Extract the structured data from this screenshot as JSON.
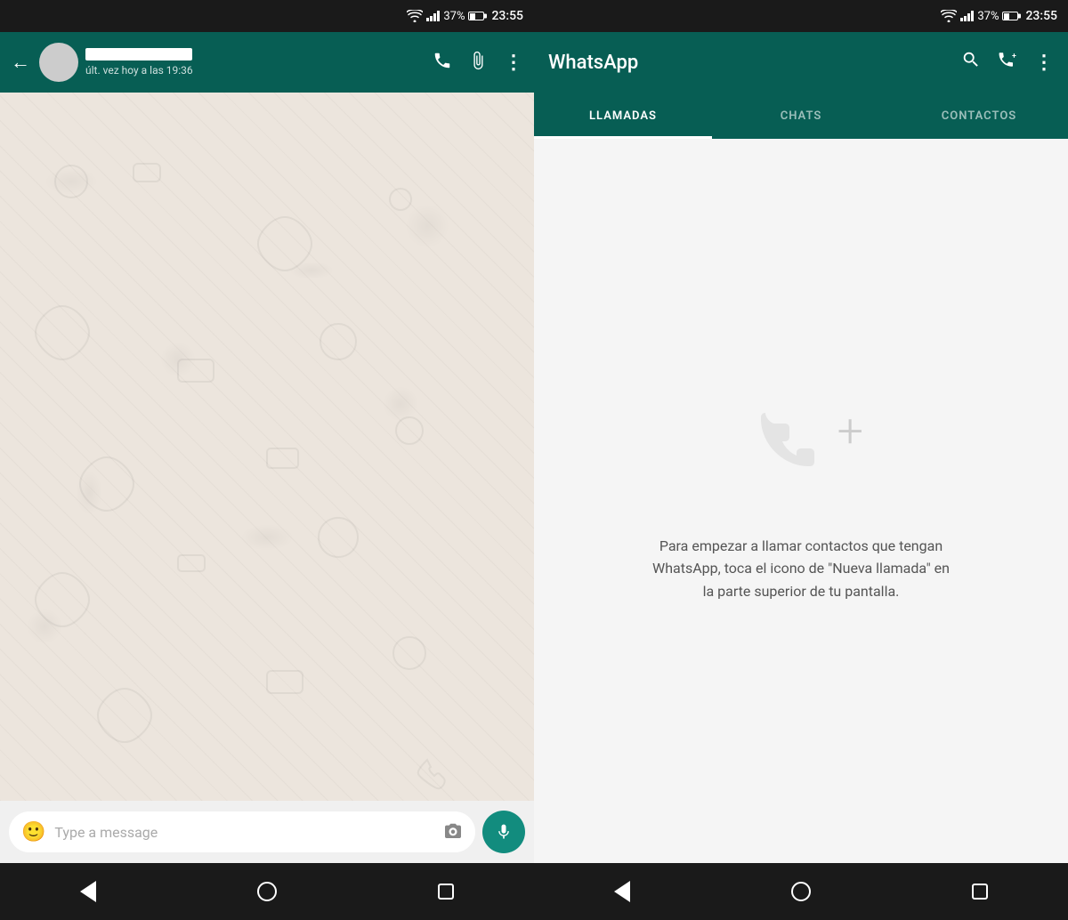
{
  "left": {
    "status_bar": {
      "wifi": "📶",
      "signal": "signal",
      "battery_pct": "37%",
      "battery_icon": "🔋",
      "time": "23:55"
    },
    "header": {
      "contact_status": "últ. vez hoy a las 19:36",
      "call_icon": "📞",
      "attach_icon": "📎",
      "menu_icon": "⋮"
    },
    "input": {
      "placeholder": "Type a message"
    },
    "nav": {
      "back": "◁",
      "home": "○",
      "recents": "□"
    }
  },
  "right": {
    "status_bar": {
      "time": "23:55",
      "battery_pct": "37%"
    },
    "header": {
      "title": "WhatsApp",
      "search_icon": "search",
      "add_call_icon": "add-call",
      "menu_icon": "menu"
    },
    "tabs": [
      {
        "id": "llamadas",
        "label": "LLAMADAS",
        "active": true
      },
      {
        "id": "chats",
        "label": "CHATS",
        "active": false
      },
      {
        "id": "contactos",
        "label": "CONTACTOS",
        "active": false
      }
    ],
    "calls_empty": {
      "description": "Para empezar a llamar contactos que tengan WhatsApp, toca el icono de \"Nueva llamada\" en la parte superior de tu pantalla."
    },
    "nav": {
      "back": "◁",
      "home": "○",
      "recents": "□"
    }
  }
}
